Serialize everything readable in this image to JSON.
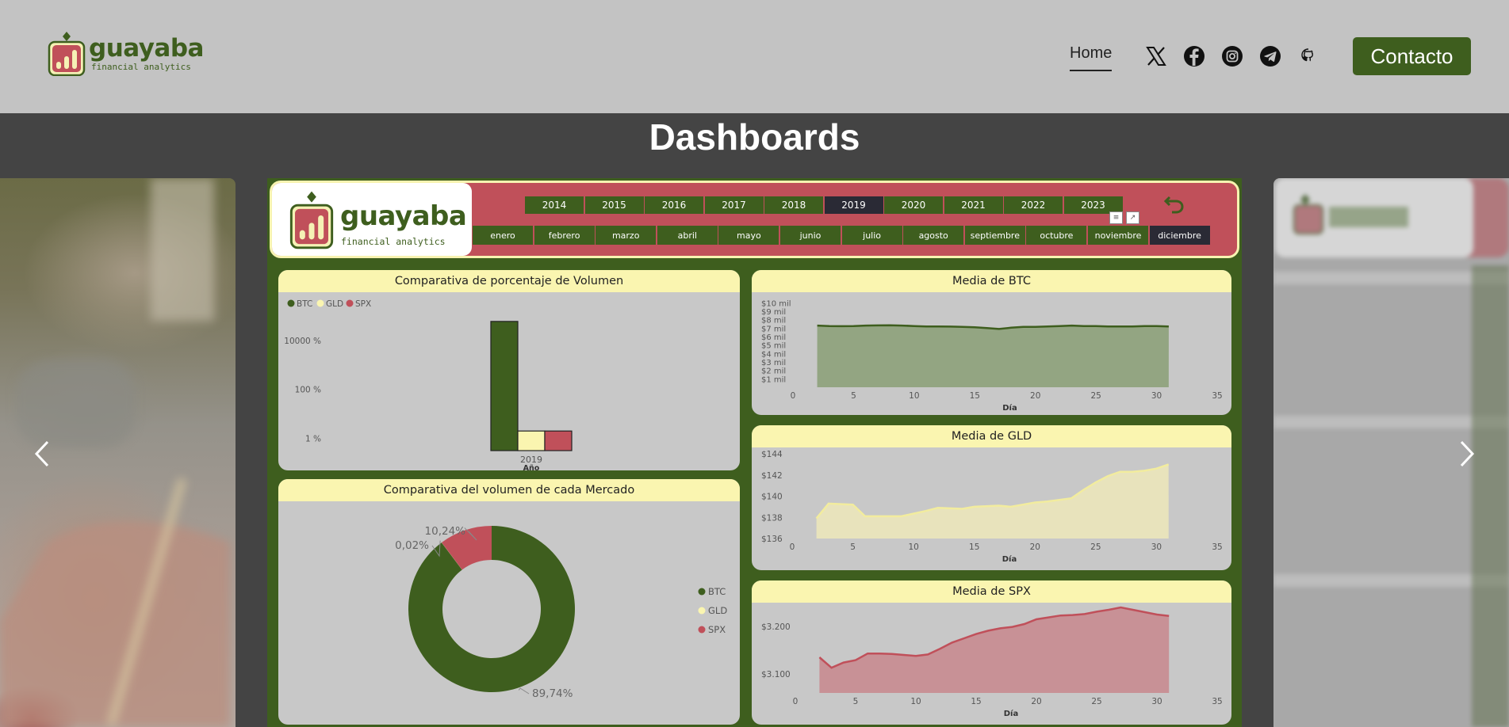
{
  "site": {
    "brand_name": "guayaba",
    "brand_sub": "financial analytics",
    "nav_home": "Home",
    "social_icons": [
      "x-icon",
      "facebook-icon",
      "instagram-icon",
      "telegram-icon",
      "github-icon"
    ],
    "contact_label": "Contacto",
    "page_heading": "Dashboards"
  },
  "dashboard": {
    "brand_name": "guayaba",
    "brand_sub": "financial analytics",
    "years": [
      "2014",
      "2015",
      "2016",
      "2017",
      "2018",
      "2019",
      "2020",
      "2021",
      "2022",
      "2023"
    ],
    "selected_year": "2019",
    "months": [
      "enero",
      "febrero",
      "marzo",
      "abril",
      "mayo",
      "junio",
      "julio",
      "agosto",
      "septiembre",
      "octubre",
      "noviembre",
      "diciembre"
    ],
    "selected_month": "diciembre",
    "colors": {
      "btc": "#3e5e1e",
      "gld": "#faf5b0",
      "spx": "#c0505a",
      "panel": "#c8c8c8",
      "title_bg": "#faf5b0"
    }
  },
  "chart_data": [
    {
      "type": "bar",
      "title": "Comparativa de porcentaje de Volumen",
      "xlabel": "Año",
      "categories": [
        "2019"
      ],
      "scale": "log",
      "y_ticks": [
        "10000 %",
        "100 %",
        "1 %"
      ],
      "legend": [
        "BTC",
        "GLD",
        "SPX"
      ],
      "series": [
        {
          "name": "BTC",
          "values": [
            60000
          ]
        },
        {
          "name": "GLD",
          "values": [
            2
          ]
        },
        {
          "name": "SPX",
          "values": [
            2
          ]
        }
      ]
    },
    {
      "type": "pie",
      "title": "Comparativa del volumen de cada Mercado",
      "legend": [
        "BTC",
        "GLD",
        "SPX"
      ],
      "labels": [
        "BTC",
        "GLD",
        "SPX"
      ],
      "values": [
        89.74,
        0.02,
        10.24
      ],
      "data_labels": [
        "89,74%",
        "0,02%",
        "10,24%"
      ]
    },
    {
      "type": "area",
      "title": "Media de BTC",
      "xlabel": "Día",
      "x_ticks": [
        0,
        5,
        10,
        15,
        20,
        25,
        30,
        35
      ],
      "y_ticks": [
        "$1 mil",
        "$2 mil",
        "$3 mil",
        "$4 mil",
        "$5 mil",
        "$6 mil",
        "$7 mil",
        "$8 mil",
        "$9 mil",
        "$10 mil"
      ],
      "x": [
        2,
        3,
        4,
        5,
        6,
        7,
        8,
        9,
        10,
        11,
        12,
        13,
        14,
        15,
        16,
        17,
        18,
        19,
        20,
        21,
        22,
        23,
        24,
        25,
        26,
        27,
        28,
        29,
        30,
        31
      ],
      "values": [
        7300,
        7250,
        7230,
        7250,
        7300,
        7320,
        7330,
        7300,
        7250,
        7200,
        7200,
        7180,
        7150,
        7100,
        7000,
        6900,
        7050,
        7150,
        7150,
        7200,
        7250,
        7300,
        7250,
        7250,
        7200,
        7200,
        7200,
        7250,
        7250,
        7200
      ]
    },
    {
      "type": "area",
      "title": "Media de GLD",
      "xlabel": "Día",
      "x_ticks": [
        0,
        5,
        10,
        15,
        20,
        25,
        30,
        35
      ],
      "y_ticks": [
        "$136",
        "$138",
        "$140",
        "$142",
        "$144"
      ],
      "ylim": [
        136,
        144
      ],
      "x": [
        2,
        3,
        5,
        6,
        8,
        9,
        11,
        12,
        14,
        15,
        17,
        18,
        19,
        20,
        21,
        23,
        24,
        25,
        26,
        27,
        28,
        29,
        30,
        31
      ],
      "values": [
        137.9,
        139.3,
        139.2,
        138.1,
        138.1,
        138.1,
        138.6,
        138.9,
        138.8,
        139.0,
        139.1,
        139.0,
        139.2,
        139.4,
        139.5,
        139.8,
        140.6,
        141.3,
        141.9,
        142.3,
        142.3,
        142.4,
        142.6,
        143.0
      ]
    },
    {
      "type": "area",
      "title": "Media de SPX",
      "xlabel": "Día",
      "x_ticks": [
        0,
        5,
        10,
        15,
        20,
        25,
        30,
        35
      ],
      "y_ticks": [
        "$3.200",
        "$3.100"
      ],
      "ylim": [
        3060,
        3240
      ],
      "x": [
        2,
        3,
        4,
        5,
        6,
        7,
        8,
        9,
        10,
        11,
        12,
        13,
        14,
        15,
        16,
        17,
        18,
        19,
        20,
        21,
        22,
        23,
        24,
        25,
        26,
        27,
        28,
        29,
        30,
        31
      ],
      "values": [
        3135,
        3113,
        3124,
        3129,
        3143,
        3143,
        3142,
        3140,
        3138,
        3141,
        3153,
        3166,
        3175,
        3184,
        3191,
        3196,
        3199,
        3205,
        3215,
        3219,
        3223,
        3224,
        3226,
        3231,
        3235,
        3240,
        3235,
        3230,
        3225,
        3222
      ]
    }
  ]
}
